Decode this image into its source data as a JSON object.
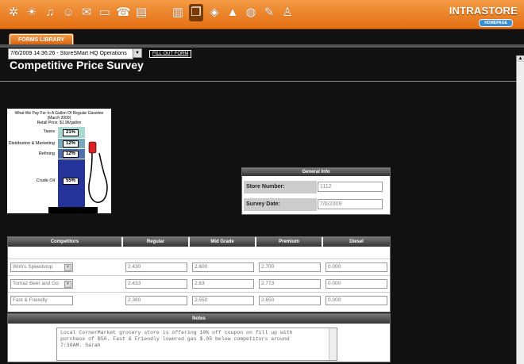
{
  "topbar": {
    "icons": [
      "compass-icon",
      "sun-icon",
      "bell-icon",
      "chat-icon",
      "mail-icon",
      "monitor-icon",
      "phone-icon",
      "book-icon",
      "binder-icon",
      "pages-icon",
      "stack-icon",
      "graduation-icon",
      "globe-icon",
      "clipboard-icon",
      "people-icon"
    ],
    "brand": "INTRASTORE",
    "home_label": "HOMEPAGE",
    "accent": "#E87A1E"
  },
  "forms_library": "FORMS LIBRARY",
  "form_select": "7/6/2009 14:36:26 - StoreSMart HQ Operations",
  "fill_out_form": "FILL OUT FORM",
  "page_title": "Competitive Price Survey",
  "gas_graphic": {
    "caption_line1": "What We Pay For In A Gallon Of Regular Gasoline",
    "caption_line2": "(March 2009)",
    "caption_line3": "Retail Price: $1.96/gallon",
    "segments": [
      {
        "label": "Taxes",
        "pct": "21%",
        "color": "#a9d8d0"
      },
      {
        "label": "Distribution & Marketing",
        "pct": "12%",
        "color": "#7aa8b8"
      },
      {
        "label": "Refining",
        "pct": "12%",
        "color": "#4f6fa8"
      },
      {
        "label": "Crude Oil",
        "pct": "55%",
        "color": "#24349a"
      }
    ]
  },
  "general_info": {
    "header": "General Info",
    "store_number_label": "Store Number:",
    "store_number_value": "1112",
    "survey_date_label": "Survey Date:",
    "survey_date_value": "7/6/2009"
  },
  "competitors": {
    "headers": [
      "Competitors",
      "Regular",
      "Mid Grade",
      "Premium",
      "Diesel"
    ],
    "rows": [
      {
        "name": "Wim's Speedstop",
        "regular": "2.430",
        "mid": "2.600",
        "premium": "2.700",
        "diesel": "0.000"
      },
      {
        "name": "Tomaz Beer and Go",
        "regular": "2.433",
        "mid": "2.63",
        "premium": "2.773",
        "diesel": "0.000"
      },
      {
        "name": "Fast & Friendly",
        "regular": "2.380",
        "mid": "2.550",
        "premium": "2.650",
        "diesel": "0.000"
      }
    ]
  },
  "notes": {
    "header": "Notes",
    "line1": "Local CornerMarket grocery store is offering 10% off coupon on fill up with",
    "line2": "purchase of $50. Fast & Friendly lowered gas $.05 below competitors around",
    "line3": "7:30AM. Sarah"
  }
}
